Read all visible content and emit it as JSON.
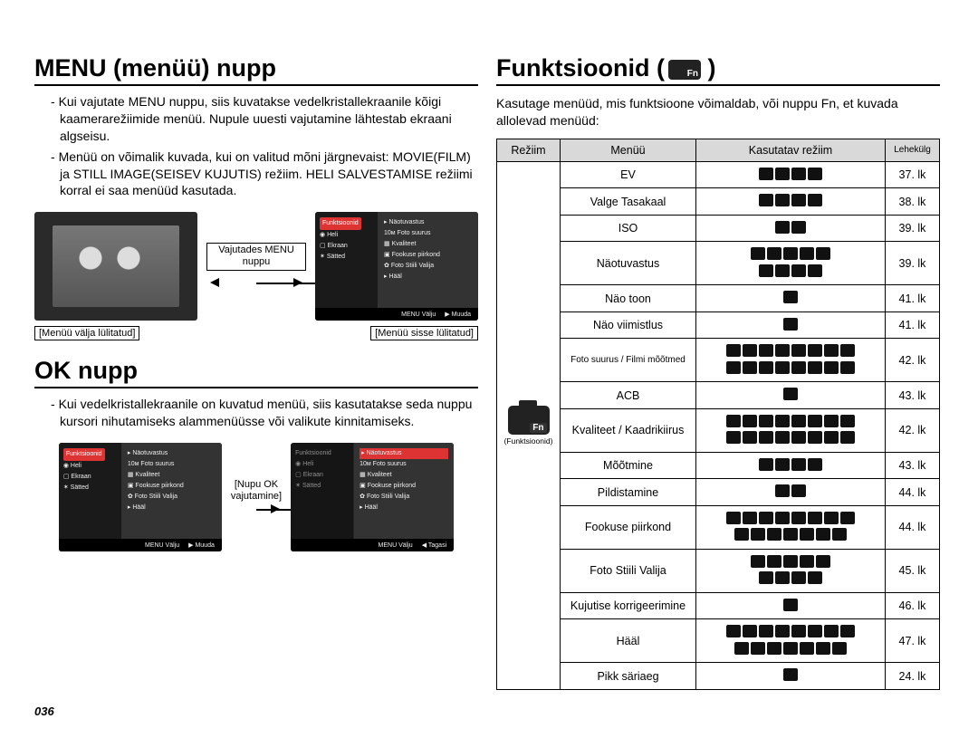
{
  "left": {
    "h1_menu": "MENU (menüü) nupp",
    "bullets_menu": [
      "Kui vajutate MENU nuppu, siis kuvatakse vedelkristallekraanile kõigi kaamerarežiimide menüü. Nupule uuesti vajutamine lähtestab ekraani algseisu.",
      "Menüü on võimalik kuvada, kui on valitud mõni järgnevaist: MOVIE(FILM) ja STILL IMAGE(SEISEV KUJUTIS) režiim. HELI SALVESTAMISE režiimi korral ei saa menüüd kasutada."
    ],
    "mid_label": "Vajutades MENU nuppu",
    "caption_left": "[Menüü välja lülitatud]",
    "caption_right": "[Menüü sisse lülitatud]",
    "h1_ok": "OK nupp",
    "bullets_ok": [
      "Kui vedelkristallekraanile on kuvatud menüü, siis kasutatakse seda nuppu kursori nihutamiseks alammenüüsse või valikute kinnitamiseks."
    ],
    "ok_mid_top": "[Nupu OK",
    "ok_mid_bot": "vajutamine]",
    "screen_menu": {
      "active": "Funktsioonid",
      "left_items": [
        "Heli",
        "Ekraan",
        "Sätted"
      ],
      "right_items": [
        "Näotuvastus",
        "Foto suurus",
        "Kvaliteet",
        "Fookuse piirkond",
        "Foto Stiili Valija",
        "Hääl"
      ],
      "bar_left": "Välju",
      "bar_right": "Muuda",
      "bar_right2": "Tagasi"
    }
  },
  "right": {
    "h1": "Funktsioonid (",
    "h1_close": ")",
    "para": "Kasutage menüüd, mis funktsioone võimaldab, või nuppu Fn, et kuvada allolevad menüüd:",
    "mode_label": "(Funktsioonid)",
    "headers": {
      "mode": "Režiim",
      "menu": "Menüü",
      "used": "Kasutatav režiim",
      "page": "Lehekülg"
    },
    "rows": [
      {
        "menu": "EV",
        "icons": 4,
        "page": "37. lk"
      },
      {
        "menu": "Valge Tasakaal",
        "icons": 4,
        "page": "38. lk"
      },
      {
        "menu": "ISO",
        "icons": 2,
        "page": "39. lk"
      },
      {
        "menu": "Näotuvastus",
        "icons": 9,
        "page": "39. lk"
      },
      {
        "menu": "Näo toon",
        "icons": 1,
        "page": "41. lk"
      },
      {
        "menu": "Näo viimistlus",
        "icons": 1,
        "page": "41. lk"
      },
      {
        "menu": "Foto suurus / Filmi mõõtmed",
        "icons": 16,
        "page": "42. lk"
      },
      {
        "menu": "ACB",
        "icons": 1,
        "page": "43. lk"
      },
      {
        "menu": "Kvaliteet / Kaadrikiirus",
        "icons": 16,
        "page": "42. lk"
      },
      {
        "menu": "Mõõtmine",
        "icons": 4,
        "page": "43. lk"
      },
      {
        "menu": "Pildistamine",
        "icons": 2,
        "page": "44. lk"
      },
      {
        "menu": "Fookuse piirkond",
        "icons": 15,
        "page": "44. lk"
      },
      {
        "menu": "Foto Stiili Valija",
        "icons": 9,
        "page": "45. lk"
      },
      {
        "menu": "Kujutise korrigeerimine",
        "icons": 1,
        "page": "46. lk"
      },
      {
        "menu": "Hääl",
        "icons": 15,
        "page": "47. lk"
      },
      {
        "menu": "Pikk säriaeg",
        "icons": 1,
        "page": "24. lk"
      }
    ]
  },
  "page_number": "036"
}
